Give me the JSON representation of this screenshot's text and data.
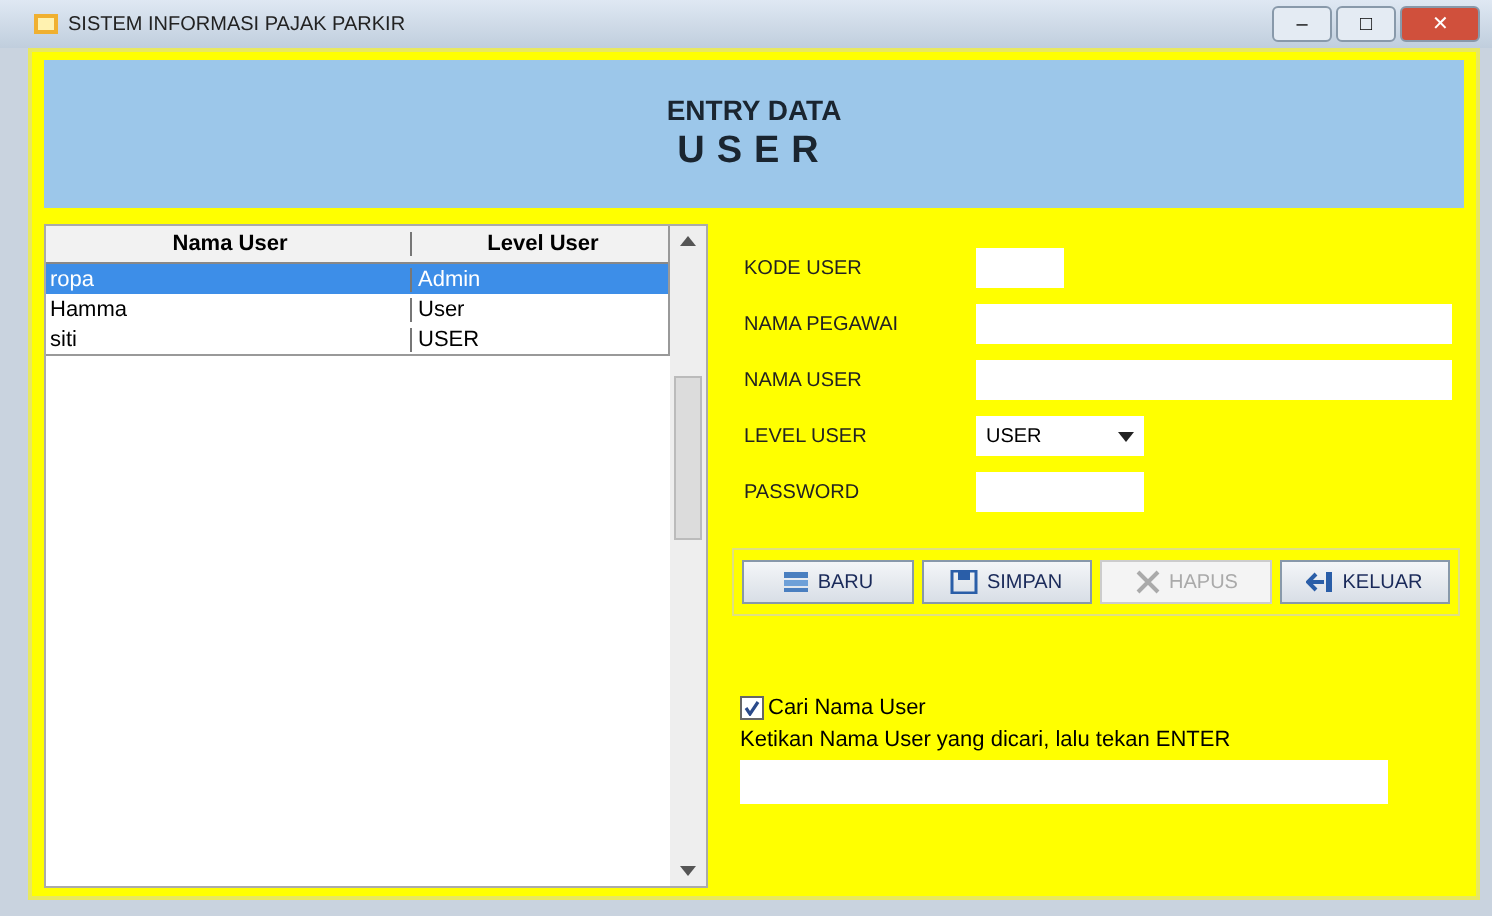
{
  "window": {
    "title": "SISTEM INFORMASI PAJAK PARKIR",
    "controls": [
      "–",
      "□",
      "✕"
    ]
  },
  "header": {
    "title": "ENTRY DATA",
    "subtitle": "USER"
  },
  "table": {
    "columns": [
      "Nama User",
      "Level User"
    ],
    "rows": [
      {
        "cells": [
          "ropa",
          "Admin"
        ],
        "selected": true
      },
      {
        "cells": [
          "Hamma",
          "User"
        ],
        "selected": false
      },
      {
        "cells": [
          "siti",
          "USER"
        ],
        "selected": false
      }
    ]
  },
  "form": {
    "fields": [
      {
        "label": "KODE USER",
        "kind": "short"
      },
      {
        "label": "NAMA PEGAWAI",
        "kind": "wide"
      },
      {
        "label": "NAMA USER",
        "kind": "wide"
      },
      {
        "label": "LEVEL USER",
        "kind": "combo",
        "value": "USER"
      },
      {
        "label": "PASSWORD",
        "kind": "medium"
      }
    ],
    "buttons": [
      {
        "label": "BARU",
        "disabled": false
      },
      {
        "label": "SIMPAN",
        "disabled": false
      },
      {
        "label": "HAPUS",
        "disabled": true
      },
      {
        "label": "KELUAR",
        "disabled": false
      }
    ]
  },
  "search": {
    "checkbox": {
      "label": "Cari Nama User",
      "checked": true
    },
    "hint": "Ketikan Nama User yang dicari, lalu tekan ENTER"
  }
}
